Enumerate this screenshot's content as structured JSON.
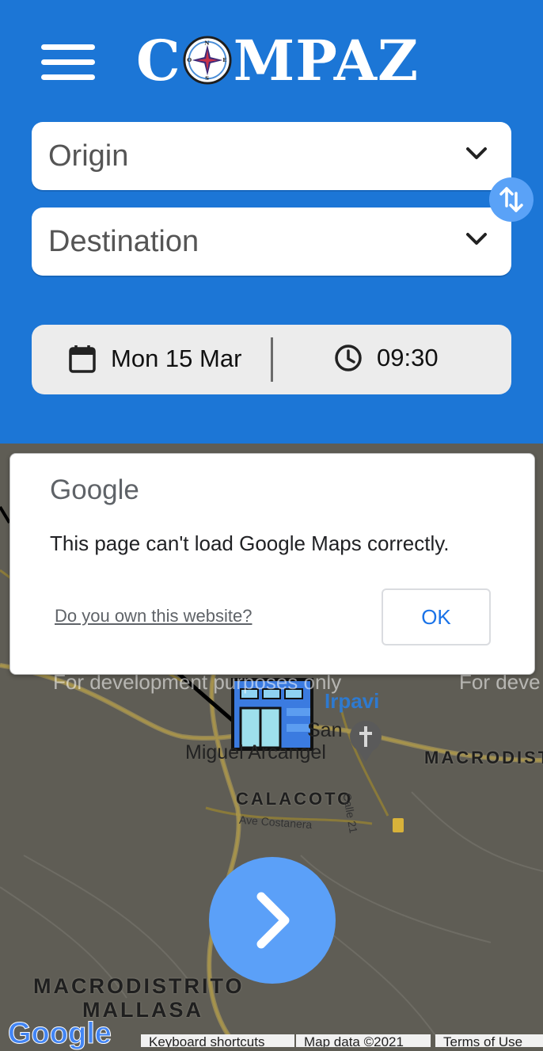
{
  "header": {
    "logo": {
      "before": "C",
      "after": "MPAZ",
      "compass_letters": {
        "n": "N",
        "e": "E",
        "s": "S",
        "o": "O"
      }
    },
    "origin_placeholder": "Origin",
    "destination_placeholder": "Destination",
    "date_label": "Mon 15 Mar",
    "time_label": "09:30",
    "colors": {
      "primary": "#1c76d6",
      "accent": "#5aa2f7"
    }
  },
  "map": {
    "watermarks": [
      "For development purposes only",
      "For development purposes only",
      "For deve"
    ],
    "labels": {
      "irpavi": "Irpavi",
      "san": "San",
      "miguel_arcangel": "Miguel Arcangel",
      "macrodistrito_right": "MACRODISTRI",
      "calacoto": "CALACOTO",
      "calle21": "Calle 21",
      "ave_costanera": "Ave Costanera",
      "macrodistrito_bottom": "MACRODISTRITO",
      "mallasa": "MALLASA"
    },
    "branding": "Google",
    "footer": {
      "shortcuts": "Keyboard shortcuts",
      "map_data": "Map data ©2021",
      "terms": "Terms of Use"
    }
  },
  "dialog": {
    "brand": "Google",
    "message": "This page can't load Google Maps correctly.",
    "link": "Do you own this website?",
    "ok": "OK"
  }
}
